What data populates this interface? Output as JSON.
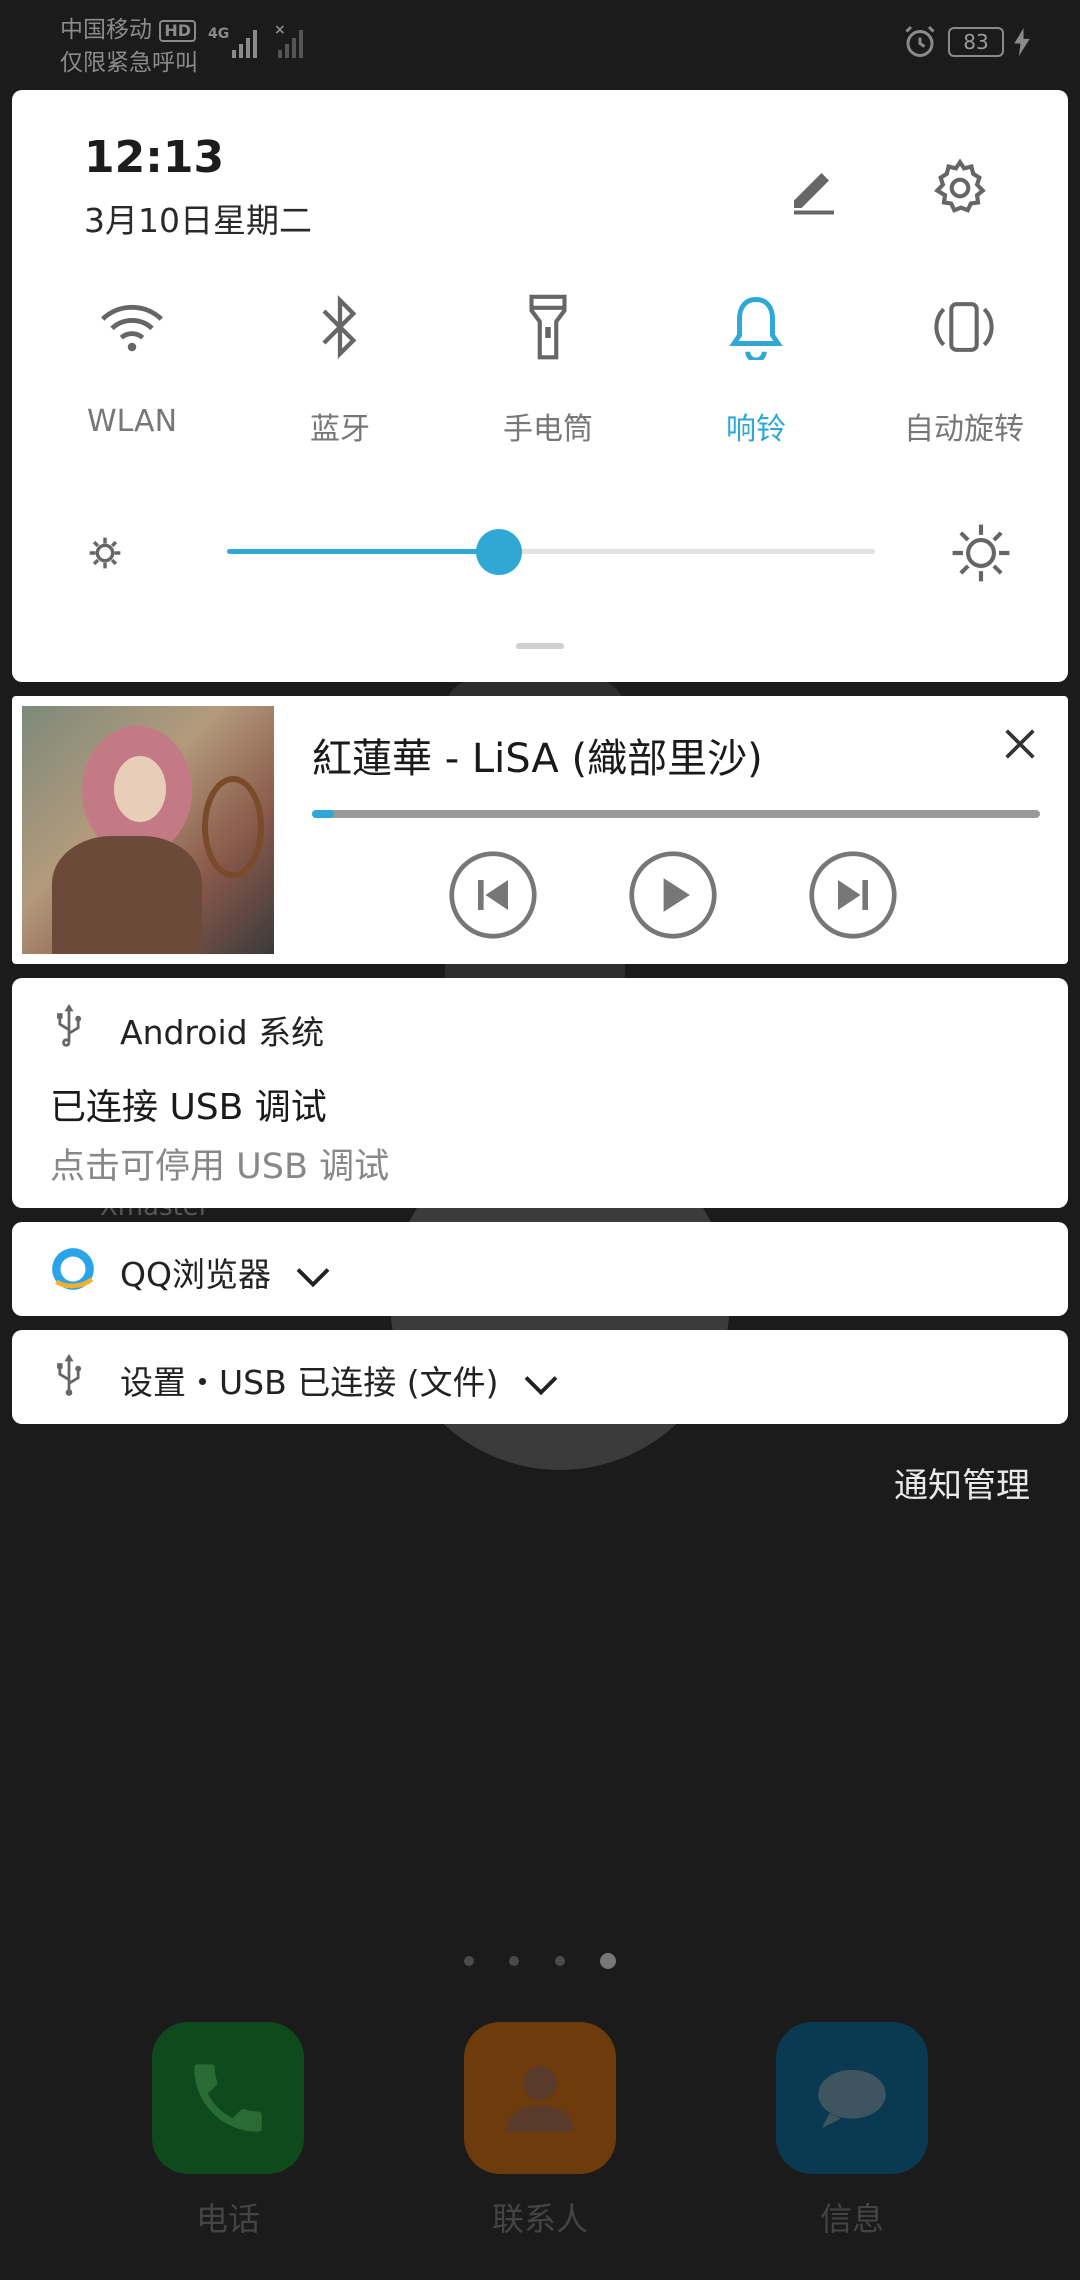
{
  "status_bar": {
    "carrier": "中国移动",
    "hd_badge": "HD",
    "emergency": "仅限紧急呼叫",
    "network": "4G",
    "battery": "83"
  },
  "quick_settings": {
    "time": "12:13",
    "date": "3月10日星期二",
    "tiles": [
      {
        "label": "WLAN",
        "icon": "wifi-icon",
        "active": false
      },
      {
        "label": "蓝牙",
        "icon": "bluetooth-icon",
        "active": false
      },
      {
        "label": "手电筒",
        "icon": "flashlight-icon",
        "active": false
      },
      {
        "label": "响铃",
        "icon": "bell-icon",
        "active": true
      },
      {
        "label": "自动旋转",
        "icon": "auto-rotate-icon",
        "active": false
      }
    ],
    "brightness_fraction": 0.42,
    "accent": "#2fa8d6"
  },
  "media": {
    "title": "紅蓮華 - LiSA (織部里沙)",
    "progress_fraction": 0.03
  },
  "notifications": [
    {
      "app": "Android 系统",
      "title": "已连接 USB 调试",
      "text": "点击可停用 USB 调试",
      "icon": "usb-icon"
    },
    {
      "app": "QQ浏览器",
      "icon": "qq-browser-icon"
    },
    {
      "app": "设置・USB 已连接 (文件)",
      "icon": "usb-icon"
    }
  ],
  "notification_management": "通知管理",
  "background": {
    "label": "Xmaster",
    "dock": [
      {
        "label": "电话",
        "icon": "phone-icon",
        "color": "#0f4a1c"
      },
      {
        "label": "联系人",
        "icon": "contacts-icon",
        "color": "#6e3c0c"
      },
      {
        "label": "信息",
        "icon": "messages-icon",
        "color": "#0a3a52"
      }
    ]
  }
}
